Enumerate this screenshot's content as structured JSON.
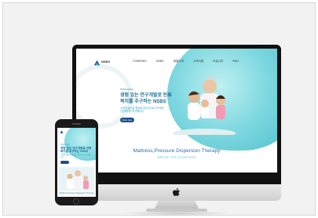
{
  "site": {
    "logo": "NSBS",
    "nav": [
      "COMPANY",
      "NSBS",
      "제품소개",
      "고객지원",
      "커뮤니티",
      "ENG"
    ],
    "eyebrow": "Welcome",
    "headline": "경험 있는 연구개발로 인류복지를 추구하는 NSBS",
    "subtext": "고객의 삶의질 향상을 최우선으로 연구하는 인류복지를 추구합니다",
    "button": "More view",
    "banner_title": "Mattress,Pressure Dispersion Therapy",
    "banner_sub": "BRICK AIR CUSHION"
  },
  "phone": {
    "eyebrow": "Welcome",
    "headline": "경험 있는 연구개발로 인류복지를 추구하는 NSBS",
    "subtext": "고객의 삶의질 향상을 최우선으로 연구합니다",
    "banner_title": "Mattress,Pressure Dispersion Therapy"
  },
  "colors": {
    "teal": "#49bcc9",
    "navy": "#1d4f8a",
    "headline_blue": "#1d6f9b"
  }
}
